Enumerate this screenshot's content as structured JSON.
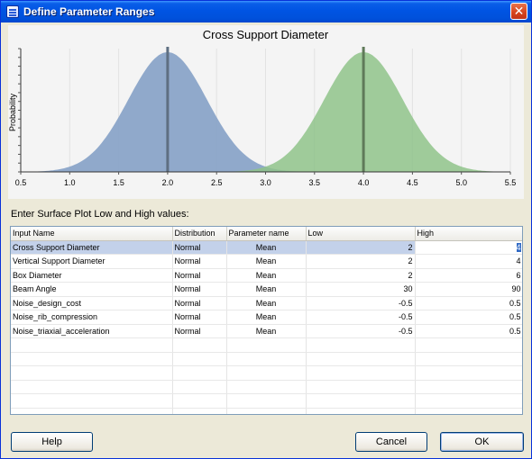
{
  "window": {
    "title": "Define Parameter Ranges",
    "close_label": "✕"
  },
  "chart": {
    "title": "Cross Support Diameter",
    "ylabel": "Probability",
    "xlim": [
      0.5,
      5.5
    ],
    "x_ticks": [
      "0.5",
      "1.0",
      "1.5",
      "2.0",
      "2.5",
      "3.0",
      "3.5",
      "4.0",
      "4.5",
      "5.0",
      "5.5"
    ],
    "colors": {
      "low": "#8aa4c8",
      "high": "#8fc38a",
      "low_line": "#5e6f82",
      "high_line": "#5f7a59",
      "background": "#f4f4f4"
    }
  },
  "chart_data": {
    "type": "area",
    "title": "Cross Support Diameter",
    "xlabel": "",
    "ylabel": "Probability",
    "xlim": [
      0.5,
      5.5
    ],
    "grid": true,
    "series": [
      {
        "mean": 2.0,
        "sd": 0.4,
        "x_range": [
          0.65,
          3.35
        ]
      },
      {
        "mean": 4.0,
        "sd": 0.4,
        "x_range": [
          2.65,
          5.35
        ]
      }
    ],
    "markers": [
      2.0,
      4.0
    ]
  },
  "prompt_label": "Enter Surface Plot Low and High values:",
  "grid": {
    "columns": [
      "Input Name",
      "Distribution",
      "Parameter name",
      "Low",
      "High"
    ],
    "rows": [
      {
        "name": "Cross Support Diameter",
        "dist": "Normal",
        "param": "Mean",
        "low": "2",
        "high": "4",
        "selected": true
      },
      {
        "name": "Vertical Support Diameter",
        "dist": "Normal",
        "param": "Mean",
        "low": "2",
        "high": "4"
      },
      {
        "name": "Box Diameter",
        "dist": "Normal",
        "param": "Mean",
        "low": "2",
        "high": "6"
      },
      {
        "name": "Beam Angle",
        "dist": "Normal",
        "param": "Mean",
        "low": "30",
        "high": "90"
      },
      {
        "name": "Noise_design_cost",
        "dist": "Normal",
        "param": "Mean",
        "low": "-0.5",
        "high": "0.5"
      },
      {
        "name": "Noise_rib_compression",
        "dist": "Normal",
        "param": "Mean",
        "low": "-0.5",
        "high": "0.5"
      },
      {
        "name": "Noise_triaxial_acceleration",
        "dist": "Normal",
        "param": "Mean",
        "low": "-0.5",
        "high": "0.5"
      }
    ]
  },
  "buttons": {
    "help": "Help",
    "cancel": "Cancel",
    "ok": "OK"
  }
}
